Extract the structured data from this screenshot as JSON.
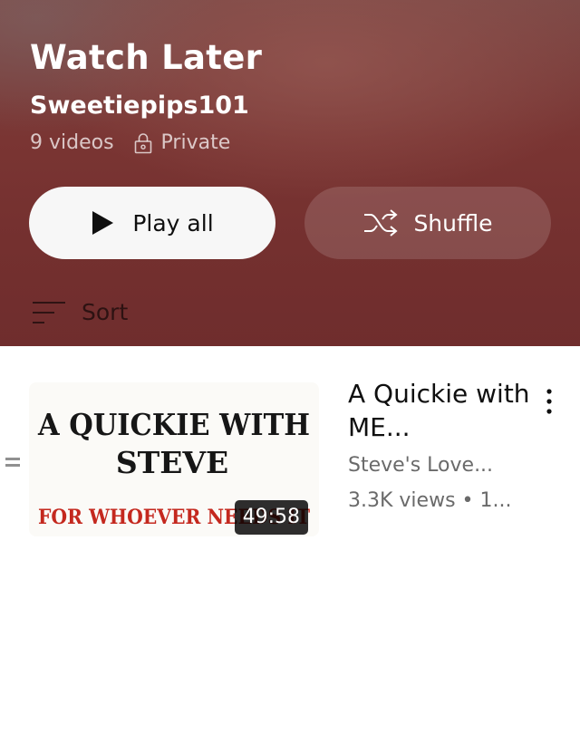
{
  "playlist": {
    "title": "Watch Later",
    "owner": "Sweetiepips101",
    "video_count": "9 videos",
    "privacy": "Private"
  },
  "actions": {
    "play_all": "Play all",
    "shuffle": "Shuffle"
  },
  "sort": {
    "label": "Sort"
  },
  "videos": [
    {
      "title": "A Quickie with ME...",
      "channel": "Steve's Love...",
      "stats": "3.3K views • 1...",
      "duration": "49:58",
      "thumbnail_text": {
        "line1": "A QUICKIE WITH",
        "line2": "STEVE",
        "line3": "FOR WHOEVER NEEDS IT"
      }
    }
  ],
  "colors": {
    "header_bg": "#7a3533",
    "play_button_bg": "#f7f7f7",
    "thumbnail_red": "#c4281e"
  },
  "icons": [
    "lock-icon",
    "play-icon",
    "shuffle-icon",
    "sort-icon",
    "drag-handle-icon",
    "more-vert-icon"
  ]
}
